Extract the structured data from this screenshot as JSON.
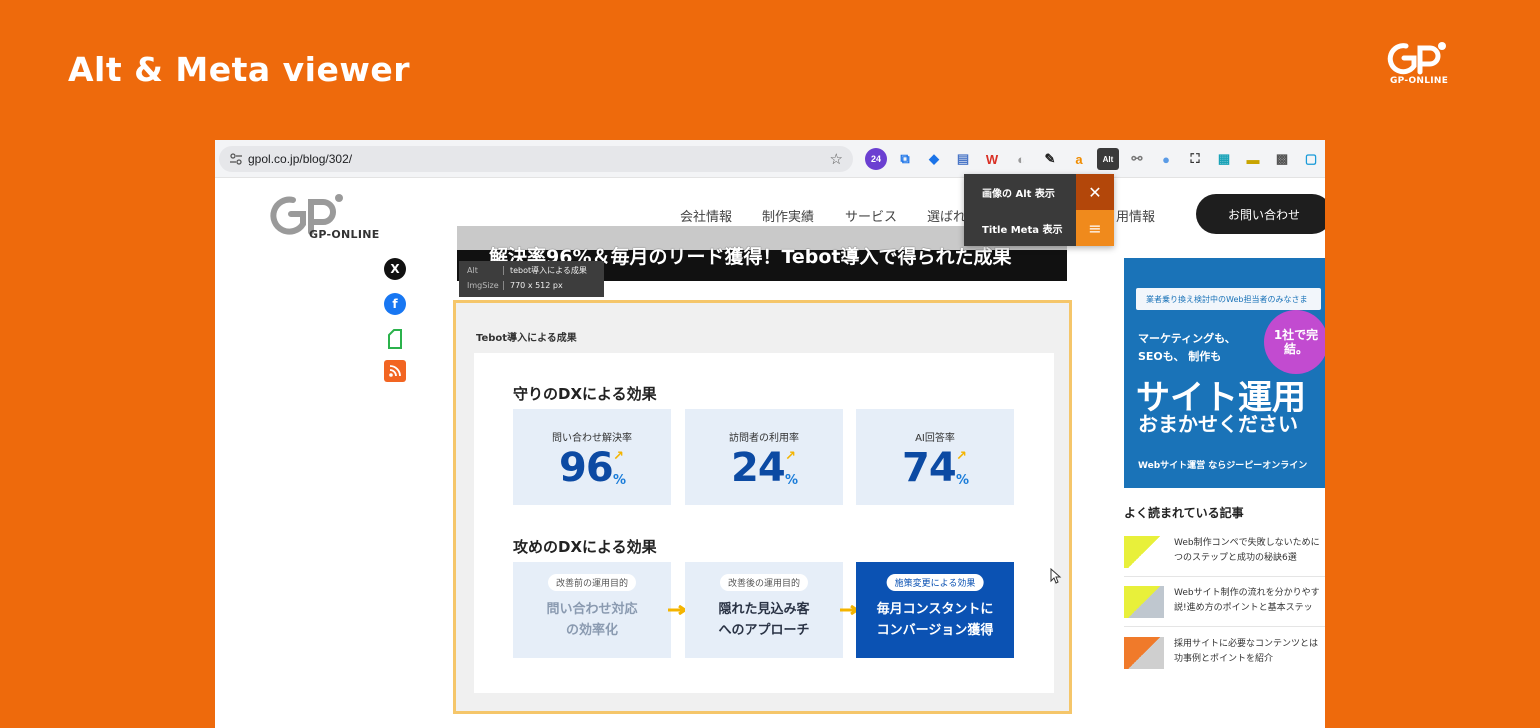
{
  "slide": {
    "title": "Alt & Meta viewer",
    "brand_name": "GP-ONLINE"
  },
  "browser": {
    "url": "gpol.co.jp/blog/302/",
    "extensions": [
      {
        "name": "notification-24-icon",
        "glyph": "24",
        "color": "#6b3fd1"
      },
      {
        "name": "screenshot-icon",
        "glyph": "⧉",
        "color": "#1a73e8"
      },
      {
        "name": "tag-icon",
        "glyph": "◆",
        "color": "#1a73e8"
      },
      {
        "name": "doc-edit-icon",
        "glyph": "▤",
        "color": "#4a76c7"
      },
      {
        "name": "w-icon",
        "glyph": "W",
        "color": "#d93025"
      },
      {
        "name": "moon-icon",
        "glyph": "◐",
        "color": "#999999"
      },
      {
        "name": "pen-icon",
        "glyph": "✎",
        "color": "#222222"
      },
      {
        "name": "amazon-icon",
        "glyph": "a",
        "color": "#f08c00"
      },
      {
        "name": "alt-viewer-icon",
        "glyph": "Alt",
        "color": "#333333"
      },
      {
        "name": "link-icon",
        "glyph": "⚯",
        "color": "#777777"
      },
      {
        "name": "globe-icon",
        "glyph": "●",
        "color": "#5a9be6"
      },
      {
        "name": "crop-icon",
        "glyph": "⛶",
        "color": "#333333"
      },
      {
        "name": "grid-icon",
        "glyph": "▦",
        "color": "#19a3b8"
      },
      {
        "name": "folder-icon",
        "glyph": "▬",
        "color": "#c8a400"
      },
      {
        "name": "qr-icon",
        "glyph": "▩",
        "color": "#555555"
      },
      {
        "name": "frame-icon",
        "glyph": "▢",
        "color": "#1a9bd9"
      }
    ]
  },
  "site": {
    "logo_text": "GP-ONLINE",
    "nav": [
      "会社情報",
      "制作実績",
      "サービス",
      "選ばれ",
      "用情報"
    ],
    "contact_label": "お問い合わせ",
    "social": [
      {
        "name": "x-icon",
        "glyph": "X",
        "color": "#111111"
      },
      {
        "name": "facebook-icon",
        "glyph": "f",
        "color": "#1877f2"
      },
      {
        "name": "feedly-icon",
        "glyph": "▯",
        "color": "#2bb24c"
      },
      {
        "name": "rss-icon",
        "glyph": "◠",
        "color": "#f26522"
      }
    ]
  },
  "popup": {
    "alt_label": "画像の Alt 表示",
    "meta_label": "Title Meta 表示"
  },
  "article": {
    "headline": "解決率96%＆毎月のリード獲得！Tebot導入で得られた成果",
    "alt_tooltip": {
      "alt_key": "Alt",
      "alt_value": "tebot導入による成果",
      "size_key": "ImgSize",
      "size_value": "770 x 512 px"
    },
    "figure": {
      "caption": "Tebot導入による成果",
      "defense_title": "守りのDXによる効果",
      "stats": [
        {
          "label": "問い合わせ解決率",
          "value": "96",
          "unit": "%"
        },
        {
          "label": "訪問者の利用率",
          "value": "24",
          "unit": "%"
        },
        {
          "label": "AI回答率",
          "value": "74",
          "unit": "%"
        }
      ],
      "offense_title": "攻めのDXによる効果",
      "flows": [
        {
          "tag": "改善前の運用目的",
          "line1": "問い合わせ対応",
          "line2": "の効率化"
        },
        {
          "tag": "改善後の運用目的",
          "line1": "隠れた見込み客",
          "line2": "へのアプローチ"
        },
        {
          "tag": "施策変更による効果",
          "line1": "毎月コンスタントに",
          "line2": "コンバージョン獲得"
        }
      ]
    }
  },
  "sidebar": {
    "ad": {
      "ribbon": "業者乗り換え検討中のWeb担当者のみなさま",
      "bullet1": "マーケティングも、",
      "bullet2": "SEOも、 制作も",
      "badge": "1社で完結。",
      "big": "サイト運用",
      "sub": "おまかせください",
      "foot": "Webサイト運営 ならジーピーオンライン"
    },
    "popular_title": "よく読まれている記事",
    "articles": [
      {
        "line1": "Web制作コンペで失敗しないために",
        "line2": "つのステップと成功の秘訣6選"
      },
      {
        "line1": "Webサイト制作の流れを分かりやす",
        "line2": "説!進め方のポイントと基本ステッ"
      },
      {
        "line1": "採用サイトに必要なコンテンツとは",
        "line2": "功事例とポイントを紹介"
      }
    ]
  }
}
